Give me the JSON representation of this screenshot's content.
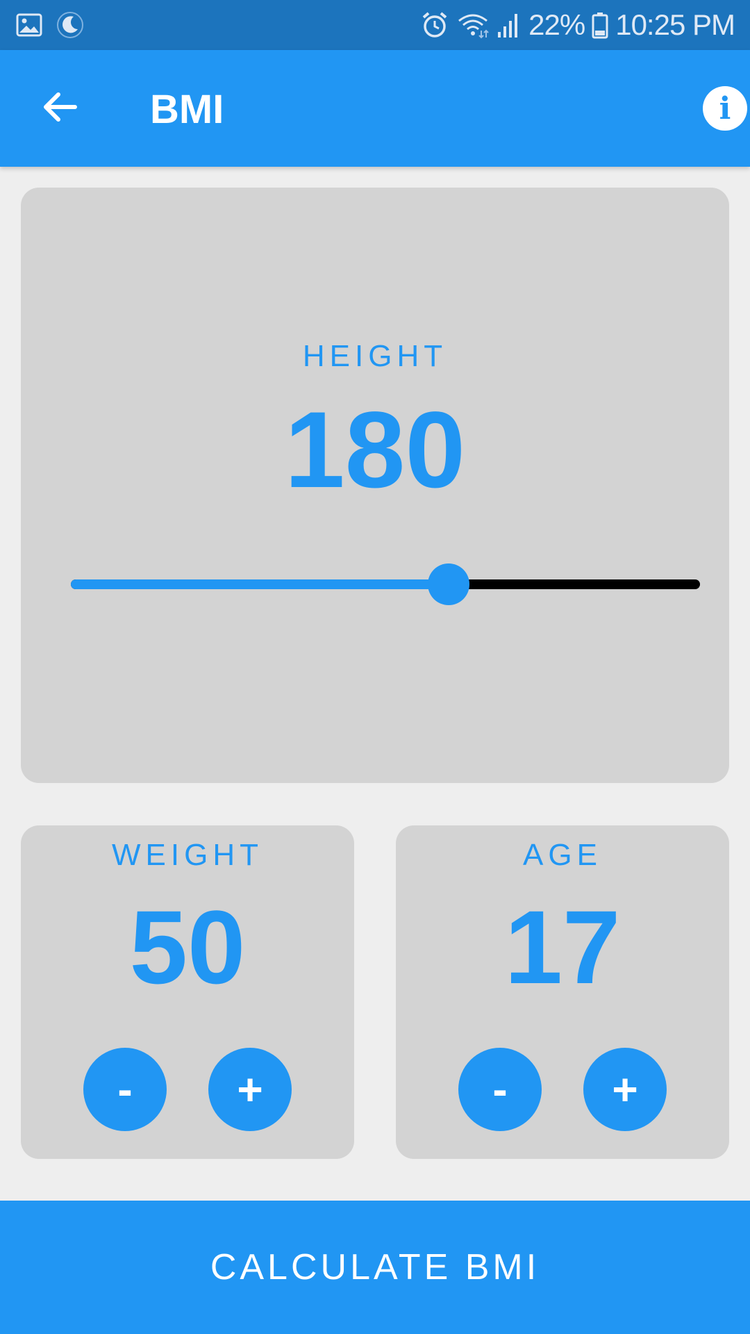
{
  "status_bar": {
    "battery": "22%",
    "time": "10:25 PM",
    "icons": [
      "gallery-icon",
      "moon-icon",
      "alarm-icon",
      "wifi-icon",
      "signal-icon",
      "battery-icon"
    ]
  },
  "app_bar": {
    "title": "BMI",
    "back_icon": "arrow-back-icon",
    "info_icon": "info-icon",
    "info_glyph": "i"
  },
  "height_card": {
    "label": "HEIGHT",
    "value": "180",
    "slider_fraction": 0.6
  },
  "weight_card": {
    "label": "WEIGHT",
    "value": "50",
    "minus_label": "-",
    "plus_label": "+"
  },
  "age_card": {
    "label": "AGE",
    "value": "17",
    "minus_label": "-",
    "plus_label": "+"
  },
  "calculate_button": {
    "label": "CALCULATE BMI"
  },
  "colors": {
    "accent": "#2196f3",
    "status_bar": "#1c74bd",
    "card": "#d3d3d3",
    "background": "#eeeeee",
    "slider_inactive": "#000000"
  }
}
